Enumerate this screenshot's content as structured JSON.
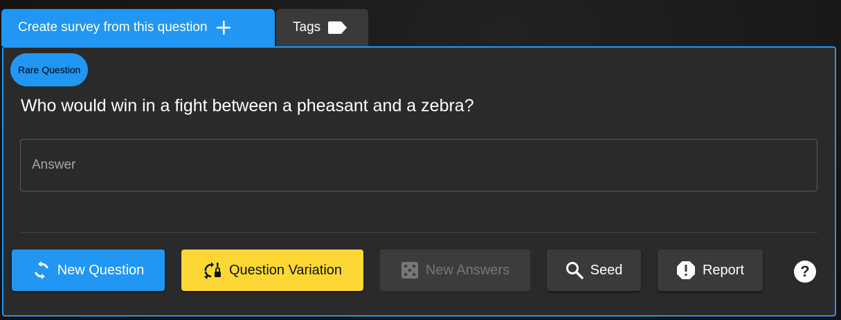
{
  "tabs": {
    "create_survey_label": "Create survey from this question",
    "tags_label": "Tags"
  },
  "question": {
    "badge": "Rare Question",
    "text": "Who would win in a fight between a pheasant and a zebra?"
  },
  "answer": {
    "placeholder": "Answer",
    "value": ""
  },
  "actions": {
    "new_question": "New Question",
    "question_variation": "Question Variation",
    "new_answers": "New Answers",
    "seed": "Seed",
    "report": "Report",
    "help": "?"
  },
  "colors": {
    "primary": "#2196f3",
    "warning": "#fdd835",
    "surface": "#2a2a2a",
    "secondary_button": "#3a3a3a"
  },
  "icons": {
    "plus": "plus-icon",
    "tag": "tag-icon",
    "refresh": "refresh-icon",
    "variation": "swap-lock-icon",
    "dice": "dice-icon",
    "search": "search-icon",
    "report": "alert-octagon-icon",
    "help": "help-circle-icon"
  }
}
